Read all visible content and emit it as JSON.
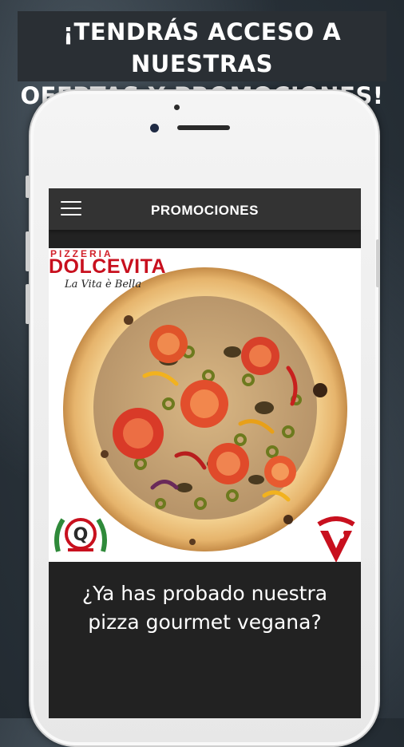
{
  "headline": {
    "line1": "¡TENDRÁS ACCESO A NUESTRAS",
    "line2": "OFERTAS Y PROMOCIONES!"
  },
  "app": {
    "title": "PROMOCIONES",
    "menu_icon": "hamburger-menu-icon"
  },
  "banner": {
    "brand_top": "PIZZERIA",
    "brand_name": "DOLCEVITA",
    "brand_tagline": "La Vita è Bella",
    "seal_letter": "Q"
  },
  "promo": {
    "line1": "¿Ya has probado nuestra",
    "line2": "pizza gourmet vegana?"
  },
  "colors": {
    "brand_red": "#c8101e",
    "appbar_bg": "#333333",
    "screen_bg": "#222222"
  }
}
